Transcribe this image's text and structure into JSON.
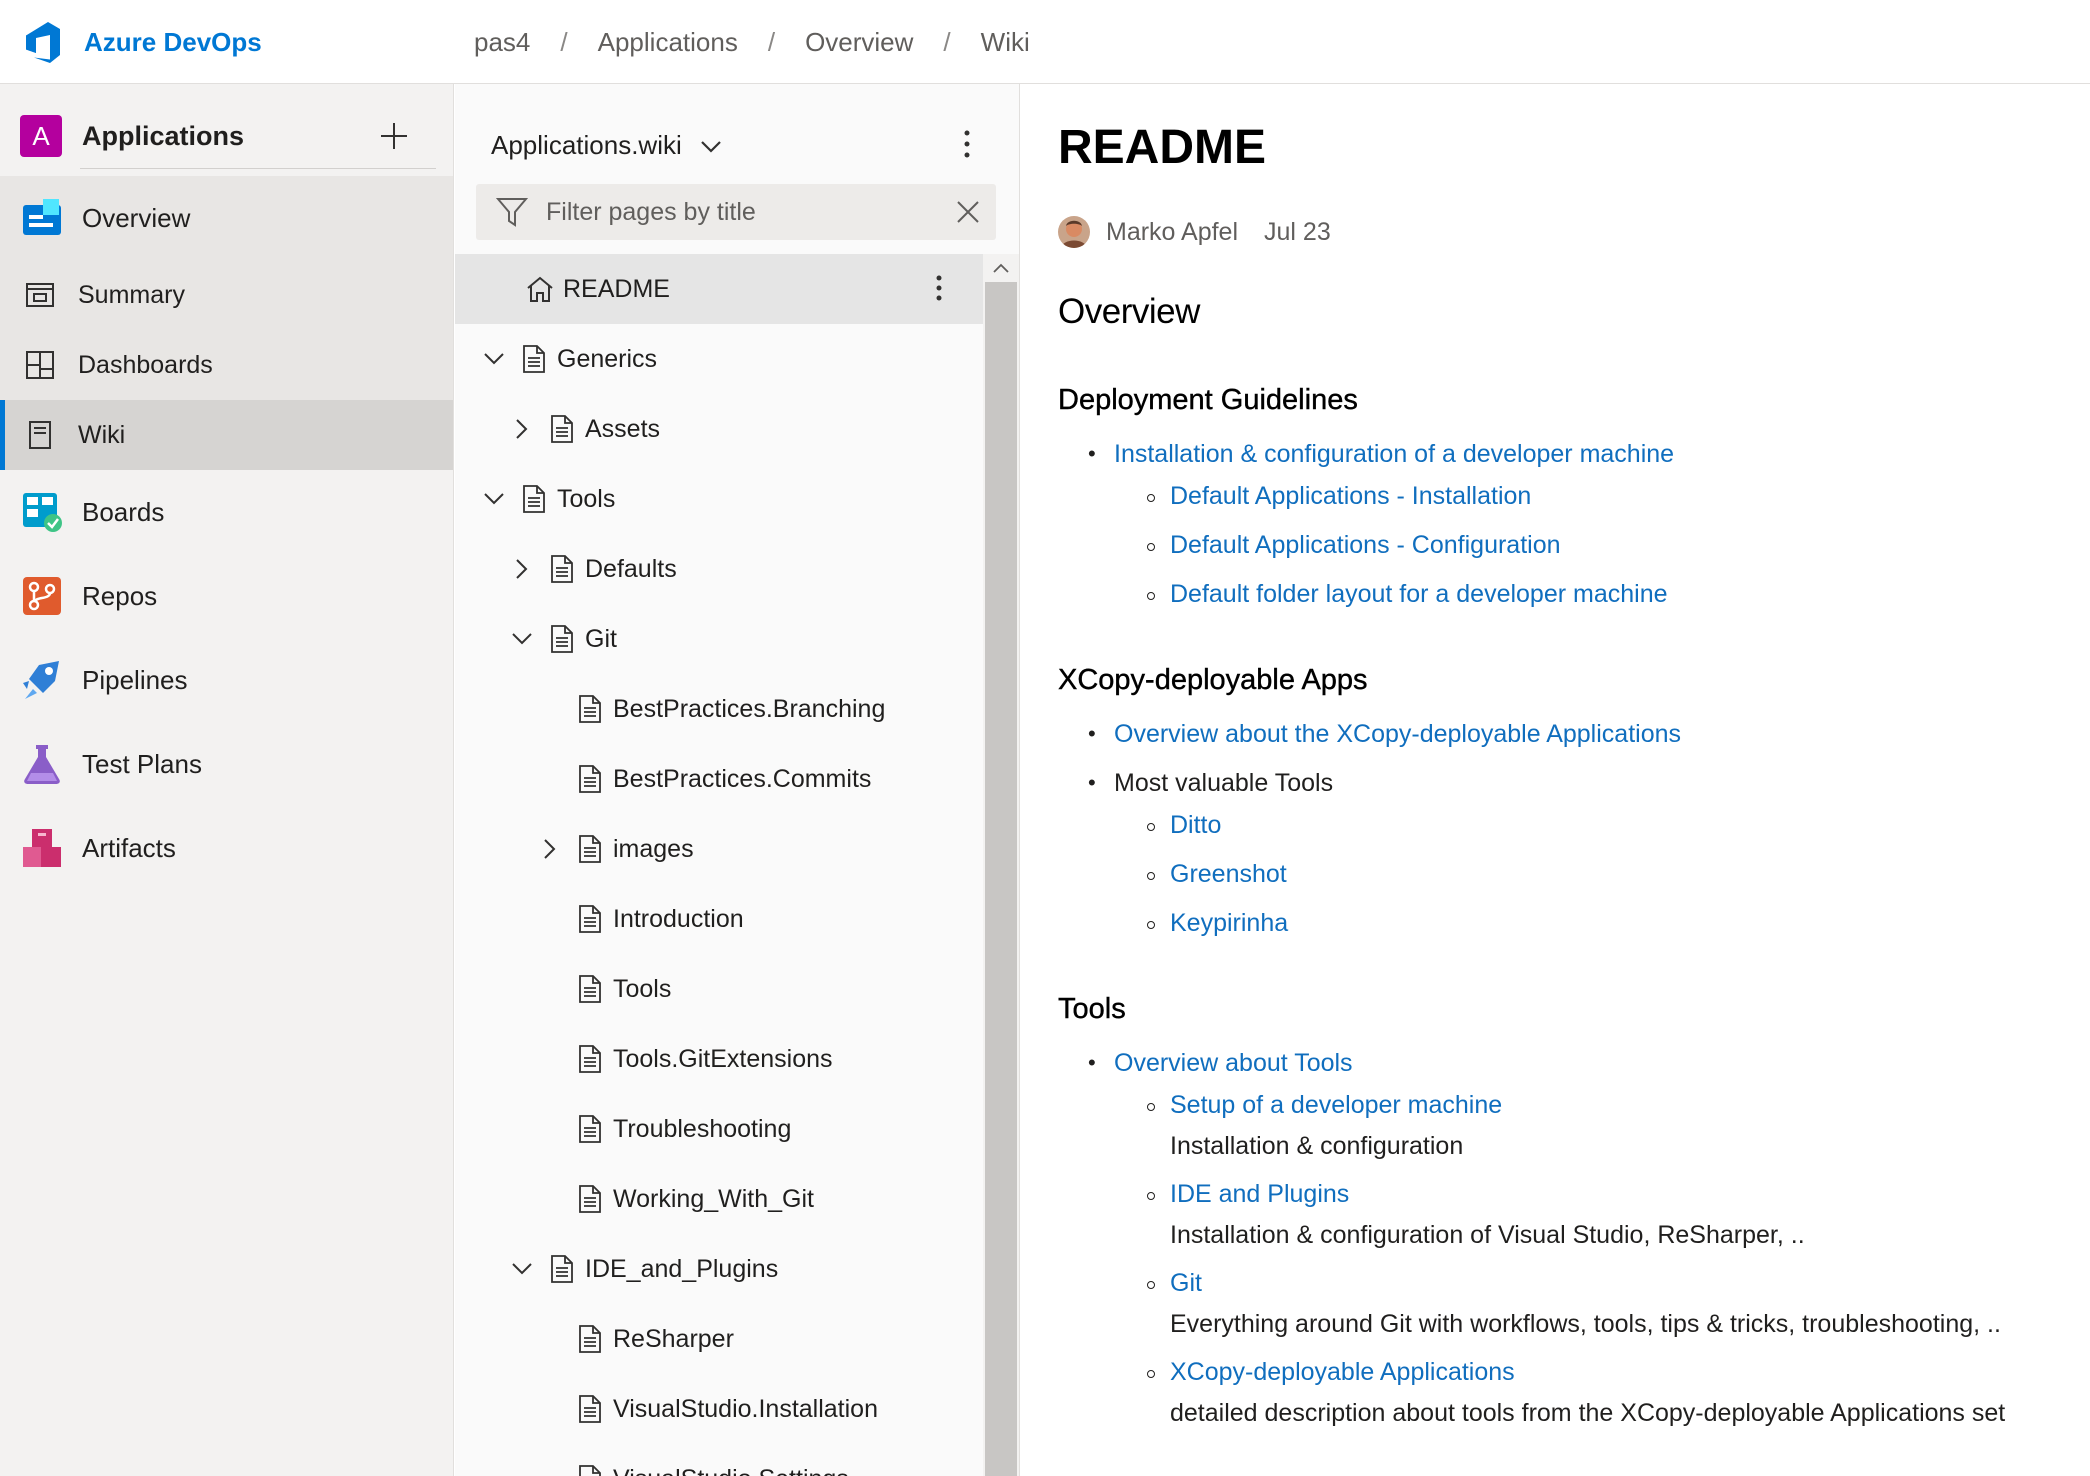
{
  "header": {
    "brand": "Azure DevOps",
    "breadcrumb": [
      "pas4",
      "Applications",
      "Overview",
      "Wiki"
    ],
    "accent": "#0078d4"
  },
  "sidebar": {
    "project": {
      "initial": "A",
      "name": "Applications",
      "add_icon": "plus-icon",
      "avatar_color": "#b4009e"
    },
    "items": [
      {
        "label": "Overview",
        "icon": "overview-icon"
      },
      {
        "label": "Summary",
        "icon": "summary-icon"
      },
      {
        "label": "Dashboards",
        "icon": "dashboards-icon"
      },
      {
        "label": "Wiki",
        "icon": "wiki-icon",
        "active": true
      },
      {
        "label": "Boards",
        "icon": "boards-icon"
      },
      {
        "label": "Repos",
        "icon": "repos-icon"
      },
      {
        "label": "Pipelines",
        "icon": "pipelines-icon"
      },
      {
        "label": "Test Plans",
        "icon": "test-plans-icon"
      },
      {
        "label": "Artifacts",
        "icon": "artifacts-icon"
      }
    ]
  },
  "wiki": {
    "name": "Applications.wiki",
    "filter_placeholder": "Filter pages by title",
    "tree": [
      {
        "label": "README",
        "level": 0,
        "kind": "home",
        "selected": true
      },
      {
        "label": "Generics",
        "level": 0,
        "chevron": "down"
      },
      {
        "label": "Assets",
        "level": 1,
        "chevron": "right"
      },
      {
        "label": "Tools",
        "level": 0,
        "chevron": "down"
      },
      {
        "label": "Defaults",
        "level": 1,
        "chevron": "right"
      },
      {
        "label": "Git",
        "level": 1,
        "chevron": "down"
      },
      {
        "label": "BestPractices.Branching",
        "level": 2
      },
      {
        "label": "BestPractices.Commits",
        "level": 2
      },
      {
        "label": "images",
        "level": 2,
        "chevron": "right"
      },
      {
        "label": "Introduction",
        "level": 2
      },
      {
        "label": "Tools",
        "level": 2
      },
      {
        "label": "Tools.GitExtensions",
        "level": 2
      },
      {
        "label": "Troubleshooting",
        "level": 2
      },
      {
        "label": "Working_With_Git",
        "level": 2
      },
      {
        "label": "IDE_and_Plugins",
        "level": 1,
        "chevron": "down"
      },
      {
        "label": "ReSharper",
        "level": 2
      },
      {
        "label": "VisualStudio.Installation",
        "level": 2
      },
      {
        "label": "VisualStudio.Settings",
        "level": 2
      }
    ]
  },
  "page": {
    "title": "README",
    "author": "Marko Apfel",
    "date": "Jul 23",
    "h1": "Overview",
    "sections": {
      "deployment": {
        "heading": "Deployment Guidelines",
        "l1": "Installation & configuration of a developer machine",
        "l2": [
          "Default Applications - Installation",
          "Default Applications - Configuration",
          "Default folder layout for a developer machine"
        ]
      },
      "xcopy": {
        "heading": "XCopy-deployable Apps",
        "l1_link": "Overview about the XCopy-deployable Applications",
        "l1_text": "Most valuable Tools",
        "l2": [
          "Ditto",
          "Greenshot",
          "Keypirinha"
        ]
      },
      "tools": {
        "heading": "Tools",
        "l1": "Overview about Tools",
        "items": [
          {
            "link": "Setup of a developer machine",
            "desc": "Installation & configuration"
          },
          {
            "link": "IDE and Plugins",
            "desc": "Installation & configuration of Visual Studio, ReSharper, .."
          },
          {
            "link": "Git",
            "desc": "Everything around Git with workflows, tools, tips & tricks, troubleshooting, .."
          },
          {
            "link": "XCopy-deployable Applications",
            "desc": "detailed description about tools from the XCopy-deployable Applications set"
          }
        ]
      }
    },
    "link_color": "#106ebe"
  }
}
